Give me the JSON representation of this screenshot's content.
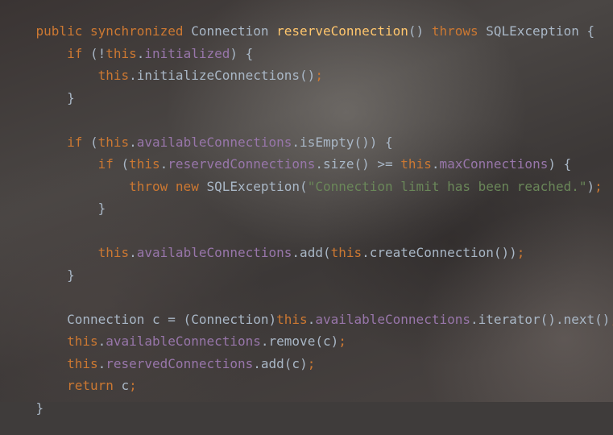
{
  "colors": {
    "keyword": "#cc7832",
    "method_declaration": "#ffc66d",
    "field": "#9876aa",
    "string": "#6a8759",
    "plain": "#a9b7c6"
  },
  "code": {
    "lines": [
      [
        {
          "type": "keyword",
          "text": "public synchronized"
        },
        {
          "type": "plain",
          "text": " Connection "
        },
        {
          "type": "method_declaration",
          "text": "reserveConnection"
        },
        {
          "type": "plain",
          "text": "() "
        },
        {
          "type": "keyword",
          "text": "throws"
        },
        {
          "type": "plain",
          "text": " SQLException {"
        }
      ],
      [
        {
          "type": "indent",
          "text": "    "
        },
        {
          "type": "keyword",
          "text": "if"
        },
        {
          "type": "plain",
          "text": " (!"
        },
        {
          "type": "keyword",
          "text": "this"
        },
        {
          "type": "plain",
          "text": "."
        },
        {
          "type": "field",
          "text": "initialized"
        },
        {
          "type": "plain",
          "text": ") {"
        }
      ],
      [
        {
          "type": "indent",
          "text": "        "
        },
        {
          "type": "keyword",
          "text": "this"
        },
        {
          "type": "plain",
          "text": ".initializeConnections()"
        },
        {
          "type": "keyword",
          "text": ";"
        }
      ],
      [
        {
          "type": "indent",
          "text": "    "
        },
        {
          "type": "plain",
          "text": "}"
        }
      ],
      [
        {
          "type": "indent",
          "text": "    "
        },
        {
          "type": "keyword",
          "text": "if"
        },
        {
          "type": "plain",
          "text": " ("
        },
        {
          "type": "keyword",
          "text": "this"
        },
        {
          "type": "plain",
          "text": "."
        },
        {
          "type": "field",
          "text": "availableConnections"
        },
        {
          "type": "plain",
          "text": ".isEmpty()) {"
        }
      ],
      [
        {
          "type": "indent",
          "text": "        "
        },
        {
          "type": "keyword",
          "text": "if"
        },
        {
          "type": "plain",
          "text": " ("
        },
        {
          "type": "keyword",
          "text": "this"
        },
        {
          "type": "plain",
          "text": "."
        },
        {
          "type": "field",
          "text": "reservedConnections"
        },
        {
          "type": "plain",
          "text": ".size() >= "
        },
        {
          "type": "keyword",
          "text": "this"
        },
        {
          "type": "plain",
          "text": "."
        },
        {
          "type": "field",
          "text": "maxConnections"
        },
        {
          "type": "plain",
          "text": ") {"
        }
      ],
      [
        {
          "type": "indent",
          "text": "            "
        },
        {
          "type": "keyword",
          "text": "throw new"
        },
        {
          "type": "plain",
          "text": " SQLException("
        },
        {
          "type": "string",
          "text": "\"Connection limit has been reached.\""
        },
        {
          "type": "plain",
          "text": ")"
        },
        {
          "type": "keyword",
          "text": ";"
        }
      ],
      [
        {
          "type": "indent",
          "text": "        "
        },
        {
          "type": "plain",
          "text": "}"
        }
      ],
      [
        {
          "type": "indent",
          "text": "        "
        },
        {
          "type": "keyword",
          "text": "this"
        },
        {
          "type": "plain",
          "text": "."
        },
        {
          "type": "field",
          "text": "availableConnections"
        },
        {
          "type": "plain",
          "text": ".add("
        },
        {
          "type": "keyword",
          "text": "this"
        },
        {
          "type": "plain",
          "text": ".createConnection())"
        },
        {
          "type": "keyword",
          "text": ";"
        }
      ],
      [
        {
          "type": "indent",
          "text": "    "
        },
        {
          "type": "plain",
          "text": "}"
        }
      ],
      [
        {
          "type": "indent",
          "text": "    "
        },
        {
          "type": "plain",
          "text": "Connection c = (Connection)"
        },
        {
          "type": "keyword",
          "text": "this"
        },
        {
          "type": "plain",
          "text": "."
        },
        {
          "type": "field",
          "text": "availableConnections"
        },
        {
          "type": "plain",
          "text": ".iterator().next()"
        },
        {
          "type": "keyword",
          "text": ";"
        }
      ],
      [
        {
          "type": "indent",
          "text": "    "
        },
        {
          "type": "keyword",
          "text": "this"
        },
        {
          "type": "plain",
          "text": "."
        },
        {
          "type": "field",
          "text": "availableConnections"
        },
        {
          "type": "plain",
          "text": ".remove(c)"
        },
        {
          "type": "keyword",
          "text": ";"
        }
      ],
      [
        {
          "type": "indent",
          "text": "    "
        },
        {
          "type": "keyword",
          "text": "this"
        },
        {
          "type": "plain",
          "text": "."
        },
        {
          "type": "field",
          "text": "reservedConnections"
        },
        {
          "type": "plain",
          "text": ".add(c)"
        },
        {
          "type": "keyword",
          "text": ";"
        }
      ],
      [
        {
          "type": "indent",
          "text": "    "
        },
        {
          "type": "keyword",
          "text": "return"
        },
        {
          "type": "plain",
          "text": " c"
        },
        {
          "type": "keyword",
          "text": ";"
        }
      ],
      [
        {
          "type": "plain",
          "text": "}"
        }
      ]
    ]
  }
}
